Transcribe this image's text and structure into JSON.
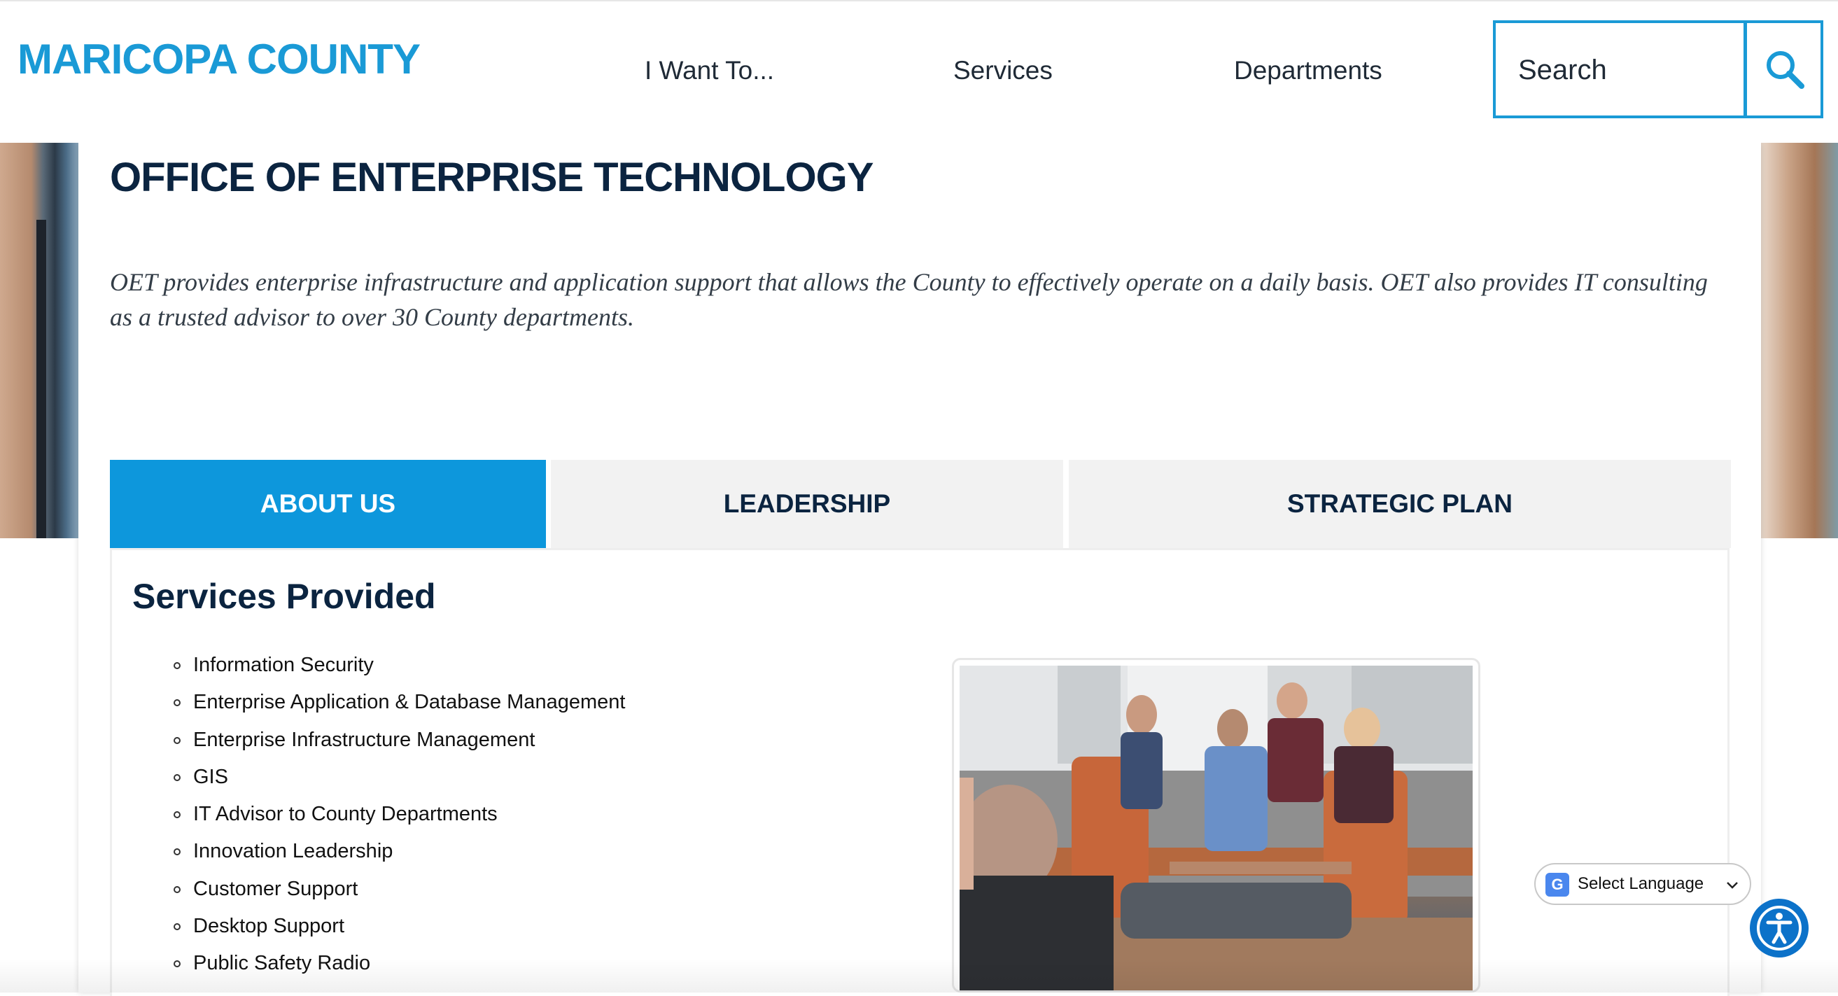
{
  "header": {
    "logo": "MARICOPA COUNTY",
    "nav": [
      "I Want To...",
      "Services",
      "Departments"
    ],
    "search_placeholder": "Search"
  },
  "page": {
    "title": "OFFICE OF ENTERPRISE TECHNOLOGY",
    "description": "OET provides enterprise infrastructure and application support that allows the County to effectively operate on a daily basis. OET also provides IT consulting as a trusted advisor to over 30 County departments."
  },
  "tabs": [
    {
      "label": "ABOUT US",
      "active": true
    },
    {
      "label": "LEADERSHIP",
      "active": false
    },
    {
      "label": "STRATEGIC PLAN",
      "active": false
    }
  ],
  "services": {
    "heading": "Services Provided",
    "items": [
      "Information Security",
      "Enterprise Application & Database Management",
      "Enterprise Infrastructure Management",
      "GIS",
      "IT Advisor to County Departments",
      "Innovation Leadership",
      "Customer Support",
      "Desktop Support",
      "Public Safety Radio"
    ]
  },
  "translate": {
    "label": "Select Language",
    "icon": "google-translate-icon"
  },
  "accessibility": {
    "icon": "accessibility-icon"
  },
  "colors": {
    "brand": "#1a9ad6",
    "active_tab": "#0d97dc",
    "heading": "#0b2440"
  }
}
